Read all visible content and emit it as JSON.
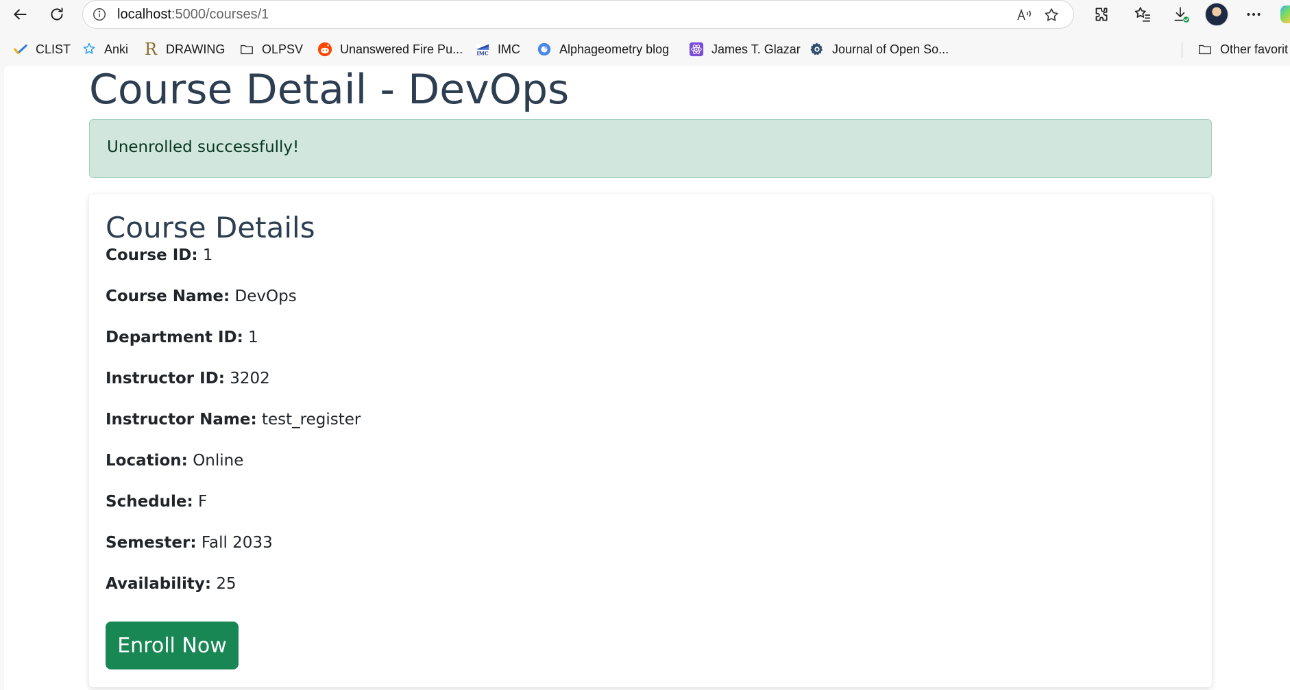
{
  "browser": {
    "url_host": "localhost",
    "url_path": ":5000/courses/1",
    "bookmarks": [
      {
        "label": "CLIST",
        "icon": "clist-icon"
      },
      {
        "label": "Anki",
        "icon": "anki-star-icon"
      },
      {
        "label": "DRAWING",
        "icon": "r-letter-icon"
      },
      {
        "label": "OLPSV",
        "icon": "folder-icon"
      },
      {
        "label": "Unanswered Fire Pu...",
        "icon": "reddit-icon"
      },
      {
        "label": "IMC",
        "icon": "imc-logo-icon"
      },
      {
        "label": "Alphageometry blog",
        "icon": "google-blue-icon"
      },
      {
        "label": "James T. Glazar",
        "icon": "react-icon"
      },
      {
        "label": "Journal of Open So...",
        "icon": "gear-icon"
      }
    ],
    "other_favorites": "Other favorit"
  },
  "page": {
    "title": "Course Detail - DevOps",
    "alert": "Unenrolled successfully!",
    "card_title": "Course Details",
    "details": [
      {
        "key": "Course ID:",
        "value": "1"
      },
      {
        "key": "Course Name:",
        "value": "DevOps"
      },
      {
        "key": "Department ID:",
        "value": "1"
      },
      {
        "key": "Instructor ID:",
        "value": "3202"
      },
      {
        "key": "Instructor Name:",
        "value": "test_register"
      },
      {
        "key": "Location:",
        "value": "Online"
      },
      {
        "key": "Schedule:",
        "value": "F"
      },
      {
        "key": "Semester:",
        "value": "Fall 2033"
      },
      {
        "key": "Availability:",
        "value": "25"
      }
    ],
    "enroll_label": "Enroll Now"
  },
  "colors": {
    "heading": "#2c3e50",
    "alert_bg": "#d1e7dd",
    "alert_text": "#0a3622",
    "button_bg": "#198754"
  }
}
